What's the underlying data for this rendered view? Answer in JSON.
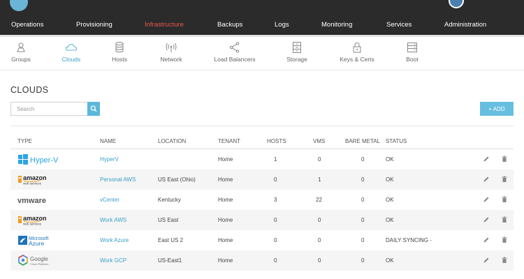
{
  "main_nav": [
    "Operations",
    "Provisioning",
    "Infrastructure",
    "Backups",
    "Logs",
    "Monitoring",
    "Services",
    "Administration"
  ],
  "main_nav_active": "Infrastructure",
  "sub_nav": [
    {
      "label": "Groups",
      "icon": "person-pin-icon"
    },
    {
      "label": "Clouds",
      "icon": "cloud-icon"
    },
    {
      "label": "Hosts",
      "icon": "database-icon"
    },
    {
      "label": "Network",
      "icon": "wifi-antenna-icon"
    },
    {
      "label": "Load Balancers",
      "icon": "share-nodes-icon"
    },
    {
      "label": "Storage",
      "icon": "storage-cabinet-icon"
    },
    {
      "label": "Keys & Certs",
      "icon": "lock-icon"
    },
    {
      "label": "Boot",
      "icon": "boot-server-icon"
    }
  ],
  "sub_nav_active": "Clouds",
  "page_title": "CLOUDS",
  "search": {
    "placeholder": "Search"
  },
  "add_button": "+ ADD",
  "table": {
    "headers": [
      "TYPE",
      "NAME",
      "LOCATION",
      "TENANT",
      "HOSTS",
      "VMS",
      "BARE METAL",
      "STATUS"
    ],
    "rows": [
      {
        "type_logo": "Hyper-V",
        "name": "HyperV",
        "location": "",
        "tenant": "Home",
        "hosts": "1",
        "vms": "0",
        "bare_metal": "0",
        "status": "OK"
      },
      {
        "type_logo": "amazon",
        "type_sub": "web services",
        "name": "Personal AWS",
        "location": "US East (Ohio)",
        "tenant": "Home",
        "hosts": "0",
        "vms": "1",
        "bare_metal": "0",
        "status": "OK"
      },
      {
        "type_logo": "vmware",
        "name": "vCenter",
        "location": "Kentucky",
        "tenant": "Home",
        "hosts": "3",
        "vms": "22",
        "bare_metal": "0",
        "status": "OK"
      },
      {
        "type_logo": "amazon",
        "type_sub": "web services",
        "name": "Work AWS",
        "location": "US East",
        "tenant": "Home",
        "hosts": "0",
        "vms": "0",
        "bare_metal": "0",
        "status": "OK"
      },
      {
        "type_logo": "Microsoft",
        "type_sub": "Azure",
        "name": "Work Azure",
        "location": "East US 2",
        "tenant": "Home",
        "hosts": "0",
        "vms": "0",
        "bare_metal": "0",
        "status": "DAILY SYNCING -"
      },
      {
        "type_logo": "Google",
        "type_sub": "Cloud Platform",
        "name": "Work GCP",
        "location": "US-East1",
        "tenant": "Home",
        "hosts": "0",
        "vms": "0",
        "bare_metal": "0",
        "status": "OK"
      }
    ]
  },
  "colors": {
    "nav_bg": "#2b2b2b",
    "nav_active": "#e8564b",
    "accent": "#3a9fc8",
    "add_button": "#67bfe0"
  }
}
